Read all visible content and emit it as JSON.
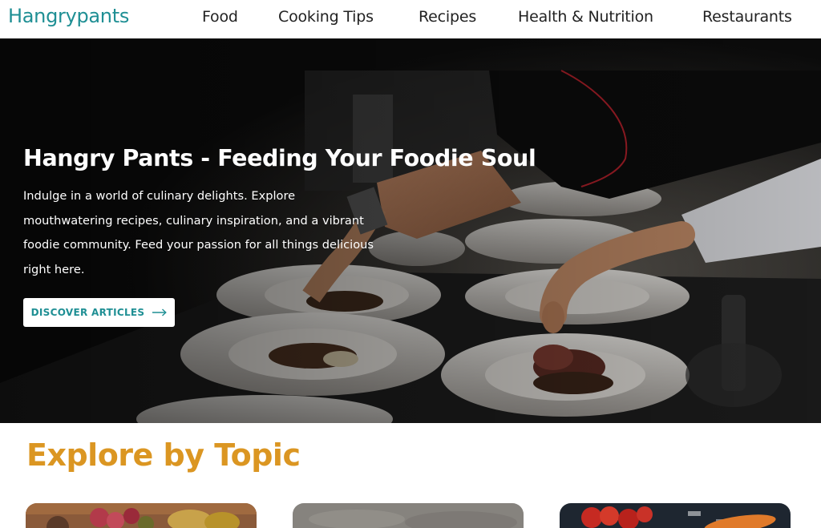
{
  "header": {
    "logo": "Hangrypants",
    "nav": [
      "Food",
      "Cooking Tips",
      "Recipes",
      "Health & Nutrition",
      "Restaurants"
    ]
  },
  "hero": {
    "title": "Hangry Pants - Feeding Your Foodie Soul",
    "lines": [
      "Indulge in a world of culinary delights. Explore",
      "mouthwatering recipes, culinary inspiration, and a vibrant",
      "foodie community. Feed your passion for all things delicious",
      "right here."
    ],
    "button_label": "DISCOVER ARTICLES",
    "button_icon": "arrow-right-icon"
  },
  "explore": {
    "title": "Explore by Topic"
  },
  "colors": {
    "brand_teal": "#1f8f94",
    "accent_orange": "#db9622",
    "nav_text": "#222222"
  }
}
